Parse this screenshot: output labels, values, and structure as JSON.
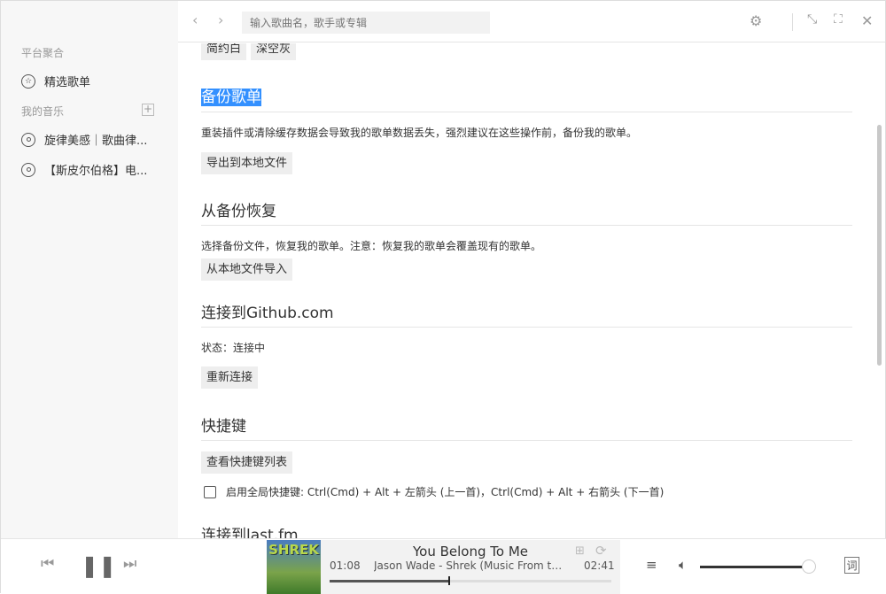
{
  "sidebar": {
    "section1": "平台聚合",
    "featured": "精选歌单",
    "section2": "我的音乐",
    "add": "+",
    "playlists": [
      "旋律美感｜歌曲律...",
      "【斯皮尔伯格】电..."
    ]
  },
  "header": {
    "back": "‹",
    "forward": "›",
    "search_placeholder": "输入歌曲名，歌手或专辑"
  },
  "content": {
    "themes": [
      "简约白",
      "深空灰"
    ],
    "backup": {
      "title": "备份歌单",
      "desc": "重装插件或清除缓存数据会导致我的歌单数据丢失，强烈建议在这些操作前，备份我的歌单。",
      "button": "导出到本地文件"
    },
    "restore": {
      "title": "从备份恢复",
      "desc": "选择备份文件，恢复我的歌单。注意：恢复我的歌单会覆盖现有的歌单。",
      "button": "从本地文件导入"
    },
    "github": {
      "title": "连接到Github.com",
      "status": "状态：连接中",
      "button": "重新连接"
    },
    "shortcuts": {
      "title": "快捷键",
      "button": "查看快捷键列表",
      "global_label": "启用全局快捷键: Ctrl(Cmd) + Alt + 左箭头 (上一首)，Ctrl(Cmd) + Alt + 右箭头 (下一首)",
      "global_checked": false
    },
    "lastfm": {
      "title": "连接到last.fm"
    }
  },
  "player": {
    "cover_text": "SHREK",
    "title": "You Belong To Me",
    "artist": "Jason Wade - Shrek (Music From th...",
    "current": "01:08",
    "total": "02:41",
    "progress": 0.42,
    "volume": 0.9,
    "lyrics": "词",
    "state": "playing"
  }
}
